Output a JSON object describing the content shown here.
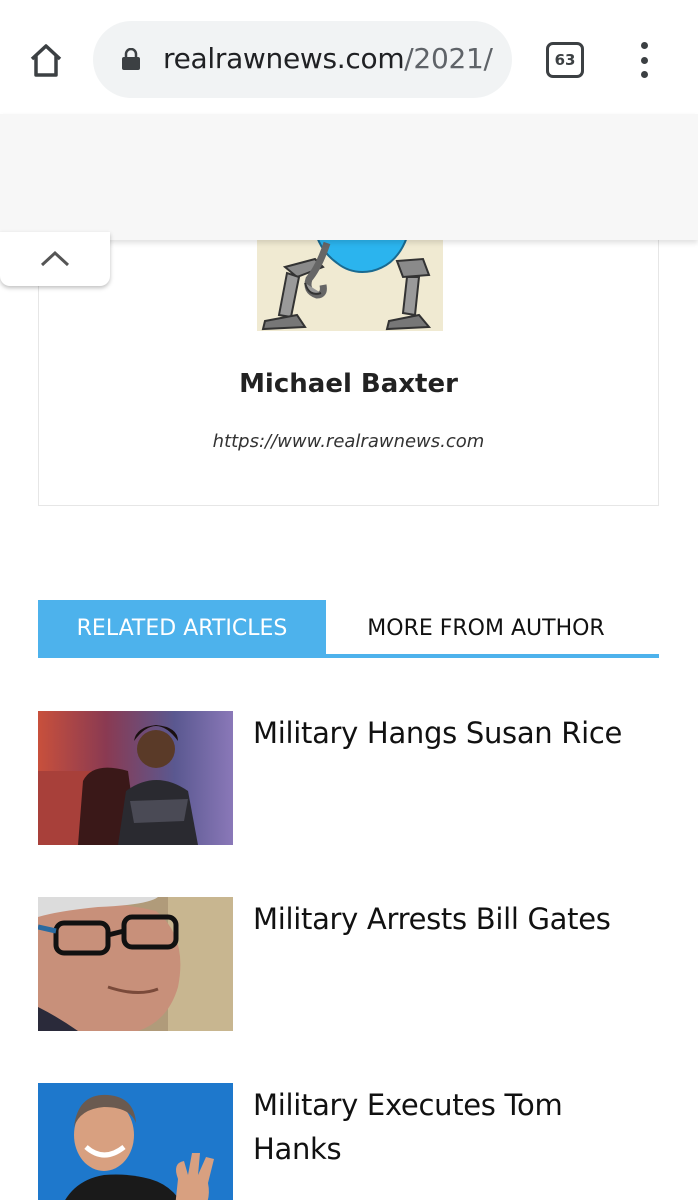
{
  "browser": {
    "url_domain": "realrawnews.com",
    "url_path": "/2021/",
    "tab_count": "63"
  },
  "author": {
    "name": "Michael Baxter",
    "website": "https://www.realrawnews.com"
  },
  "tabs": [
    {
      "label": "RELATED ARTICLES",
      "active": true
    },
    {
      "label": "MORE FROM AUTHOR",
      "active": false
    }
  ],
  "articles": [
    {
      "title": "Military Hangs Susan Rice"
    },
    {
      "title": "Military Arrests Bill Gates"
    },
    {
      "title": "Military Executes Tom Hanks"
    }
  ],
  "colors": {
    "accent": "#4db2ec",
    "omnibox_bg": "#f1f3f4",
    "icon": "#3c4043"
  }
}
